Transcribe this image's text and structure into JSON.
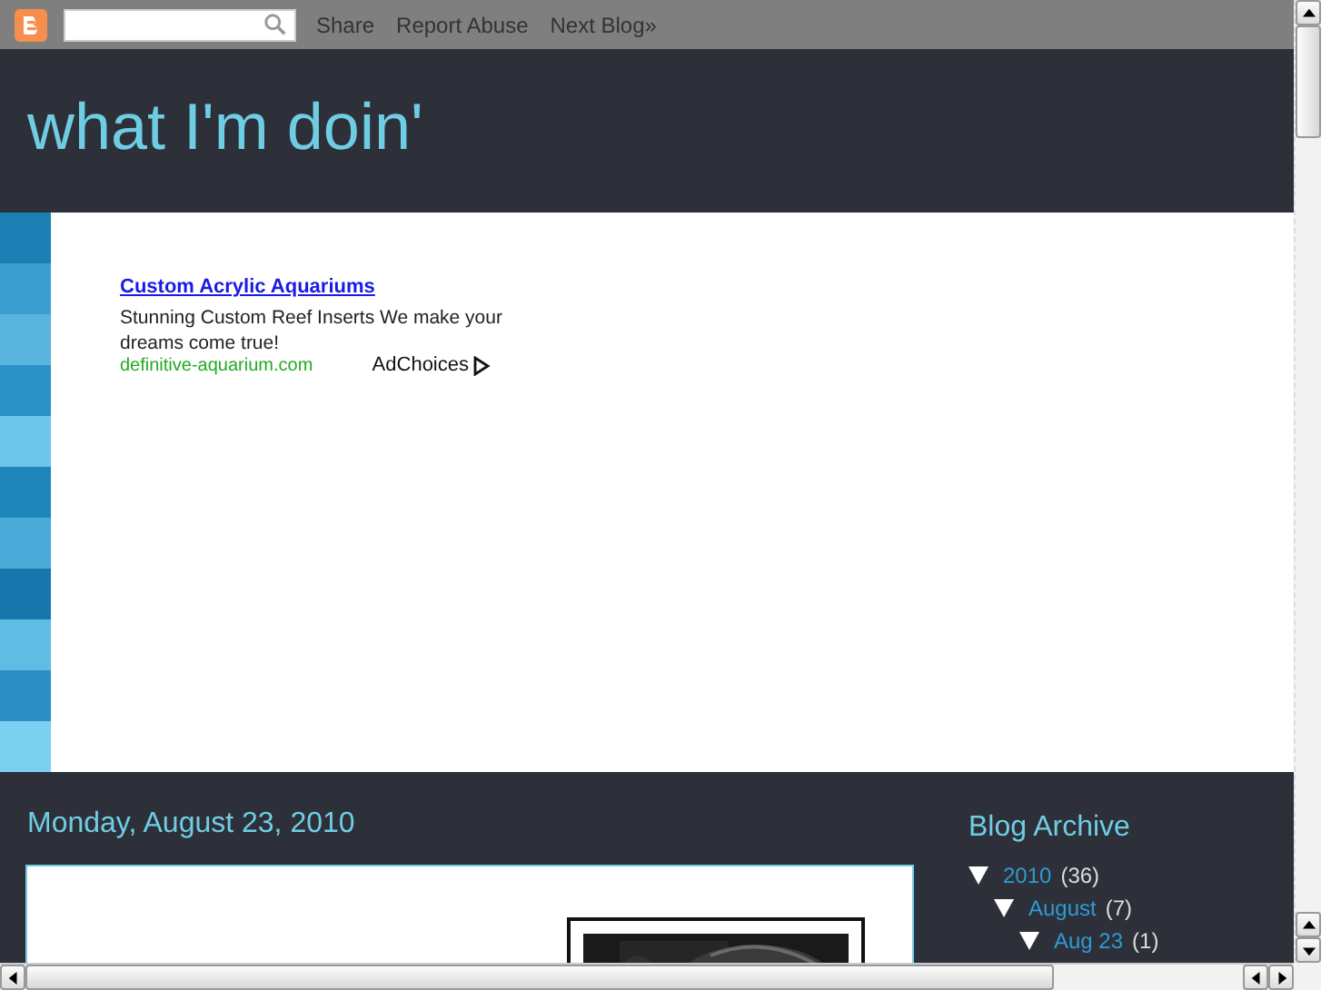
{
  "navbar": {
    "links": [
      "Share",
      "Report Abuse",
      "Next Blog»"
    ]
  },
  "blog_title": "what I'm doin'",
  "ad": {
    "title": "Custom Acrylic Aquariums",
    "text": "Stunning Custom Reef Inserts We make your dreams come true!",
    "url": "definitive-aquarium.com",
    "adchoices": "AdChoices"
  },
  "post": {
    "date": "Monday, August 23, 2010"
  },
  "sidebar": {
    "title": "Blog Archive",
    "archive": [
      {
        "label": "2010",
        "count": "(36)",
        "expanded": true,
        "children": [
          {
            "label": "August",
            "count": "(7)",
            "expanded": true,
            "children": [
              {
                "label": "Aug 23",
                "count": "(1)",
                "expanded": true
              }
            ]
          }
        ]
      }
    ]
  }
}
